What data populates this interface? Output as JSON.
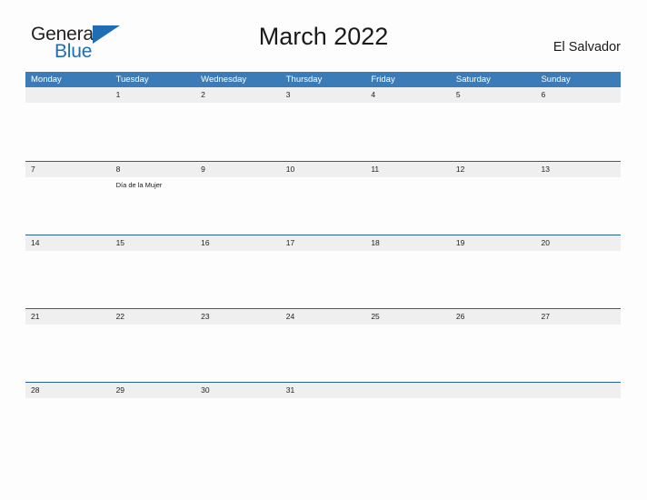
{
  "brand": {
    "name_part1": "General",
    "name_part2": "Blue",
    "accent_color": "#1f6eb5",
    "triangle_icon": "brand-triangle-icon"
  },
  "header": {
    "title": "March 2022",
    "region": "El Salvador"
  },
  "calendar": {
    "header_bg_color": "#3b7cb8",
    "band_bg_color": "#efefef",
    "row_border_color": "#2a6099",
    "weekdays": [
      "Monday",
      "Tuesday",
      "Wednesday",
      "Thursday",
      "Friday",
      "Saturday",
      "Sunday"
    ],
    "weeks": [
      {
        "days": [
          {
            "number": "",
            "events": []
          },
          {
            "number": "1",
            "events": []
          },
          {
            "number": "2",
            "events": []
          },
          {
            "number": "3",
            "events": []
          },
          {
            "number": "4",
            "events": []
          },
          {
            "number": "5",
            "events": []
          },
          {
            "number": "6",
            "events": []
          }
        ]
      },
      {
        "days": [
          {
            "number": "7",
            "events": []
          },
          {
            "number": "8",
            "events": [
              "Día de la Mujer"
            ]
          },
          {
            "number": "9",
            "events": []
          },
          {
            "number": "10",
            "events": []
          },
          {
            "number": "11",
            "events": []
          },
          {
            "number": "12",
            "events": []
          },
          {
            "number": "13",
            "events": []
          }
        ]
      },
      {
        "days": [
          {
            "number": "14",
            "events": []
          },
          {
            "number": "15",
            "events": []
          },
          {
            "number": "16",
            "events": []
          },
          {
            "number": "17",
            "events": []
          },
          {
            "number": "18",
            "events": []
          },
          {
            "number": "19",
            "events": []
          },
          {
            "number": "20",
            "events": []
          }
        ]
      },
      {
        "days": [
          {
            "number": "21",
            "events": []
          },
          {
            "number": "22",
            "events": []
          },
          {
            "number": "23",
            "events": []
          },
          {
            "number": "24",
            "events": []
          },
          {
            "number": "25",
            "events": []
          },
          {
            "number": "26",
            "events": []
          },
          {
            "number": "27",
            "events": []
          }
        ]
      },
      {
        "days": [
          {
            "number": "28",
            "events": []
          },
          {
            "number": "29",
            "events": []
          },
          {
            "number": "30",
            "events": []
          },
          {
            "number": "31",
            "events": []
          },
          {
            "number": "",
            "events": []
          },
          {
            "number": "",
            "events": []
          },
          {
            "number": "",
            "events": []
          }
        ]
      }
    ]
  }
}
